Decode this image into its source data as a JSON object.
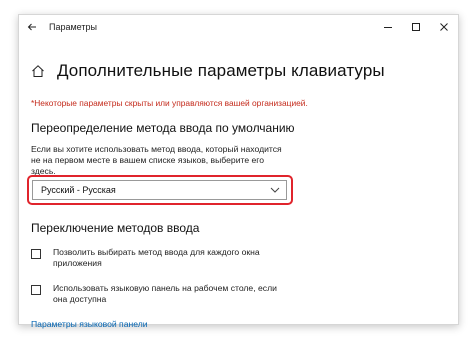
{
  "window": {
    "title": "Параметры"
  },
  "icons": {
    "back": "back-arrow-icon",
    "minimize": "minimize-icon",
    "maximize": "maximize-icon",
    "close": "close-icon",
    "home": "home-icon",
    "chevron": "chevron-down-icon"
  },
  "page": {
    "title": "Дополнительные параметры клавиатуры",
    "warning": "*Некоторые параметры скрыты или управляются вашей организацией."
  },
  "override": {
    "heading": "Переопределение метода ввода по умолчанию",
    "description": "Если вы хотите использовать метод ввода, который находится не на первом месте в вашем списке языков, выберите его здесь.",
    "selected": "Русский - Русская"
  },
  "switching": {
    "heading": "Переключение методов ввода",
    "options": [
      {
        "label": "Позволить выбирать метод ввода для каждого окна приложения",
        "checked": false
      },
      {
        "label": "Использовать языковую панель на рабочем столе, если она доступна",
        "checked": false
      }
    ],
    "link": "Параметры языковой панели"
  },
  "colors": {
    "accent_link": "#0063b1",
    "warning": "#c42b1c",
    "highlight": "#e0242c"
  }
}
